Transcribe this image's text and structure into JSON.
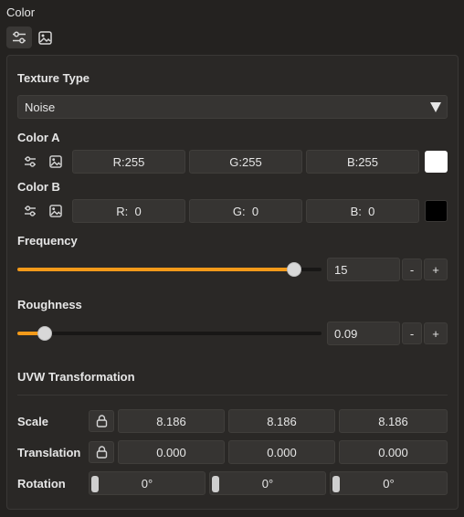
{
  "section": {
    "title": "Color"
  },
  "texture_type": {
    "label": "Texture Type",
    "value": "Noise"
  },
  "color_a": {
    "label": "Color A",
    "r": "R:255",
    "g": "G:255",
    "b": "B:255",
    "swatch": "#ffffff"
  },
  "color_b": {
    "label": "Color B",
    "r": "R:  0",
    "g": "G:  0",
    "b": "B:  0",
    "swatch": "#000000"
  },
  "frequency": {
    "label": "Frequency",
    "value": "15",
    "minus": "-",
    "plus": "+",
    "level": 0.91
  },
  "roughness": {
    "label": "Roughness",
    "value": "0.09",
    "minus": "-",
    "plus": "+",
    "level": 0.09
  },
  "uvw": {
    "title": "UVW Transformation",
    "scale": {
      "label": "Scale",
      "x": "8.186",
      "y": "8.186",
      "z": "8.186"
    },
    "translation": {
      "label": "Translation",
      "x": "0.000",
      "y": "0.000",
      "z": "0.000"
    },
    "rotation": {
      "label": "Rotation",
      "x": "0°",
      "y": "0°",
      "z": "0°"
    }
  },
  "colors": {
    "accent": "#f39a1a",
    "background": "#242220",
    "panel": "#2a2826",
    "field": "#363432"
  },
  "icons": [
    "sliders-icon",
    "image-icon",
    "lock-icon",
    "dropdown-arrow-icon"
  ]
}
